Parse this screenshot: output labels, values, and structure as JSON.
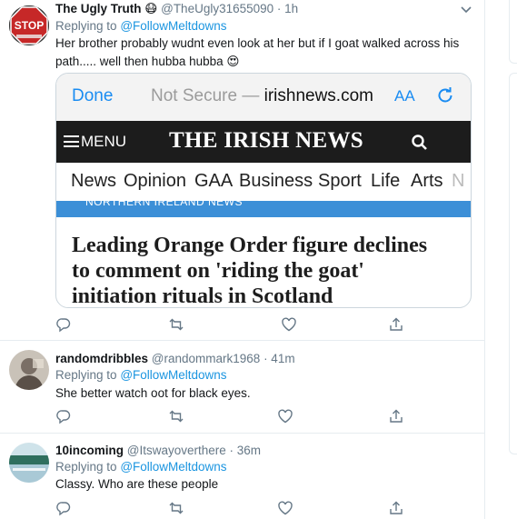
{
  "tweets": [
    {
      "name": "The Ugly Truth",
      "emoji": "😷",
      "handle": "@TheUgly31655090",
      "time": "· 1h",
      "replying_prefix": "Replying to",
      "replying_to": "@FollowMeltdowns",
      "text_line1": "Her brother probably wudnt even look at her but if I goat walked across his",
      "text_line2": "path..... well then hubba hubba",
      "text_emoji": "😍",
      "avatar_text": "STOP",
      "avatar_icon": "stop-sign-icon"
    },
    {
      "name": "randomdribbles",
      "handle": "@randommark1968",
      "time": "· 41m",
      "replying_prefix": "Replying to",
      "replying_to": "@FollowMeltdowns",
      "text": "She better watch oot for black eyes.",
      "avatar_icon": "photo-avatar"
    },
    {
      "name": "10incoming",
      "handle": "@Itswayoverthere",
      "time": "· 36m",
      "replying_prefix": "Replying to",
      "replying_to": "@FollowMeltdowns",
      "text": "Classy. Who are these people",
      "avatar_icon": "landscape-avatar"
    }
  ],
  "embedded_screenshot": {
    "done": "Done",
    "not_secure": "Not Secure —",
    "domain": "irishnews.com",
    "aa": "AA",
    "menu": "MENU",
    "masthead": "THE IRISH NEWS",
    "nav": [
      "News",
      "Opinion",
      "GAA",
      "Business",
      "Sport",
      "Life",
      "Arts",
      "N"
    ],
    "section_strip": "NORTHERN IRELAND NEWS",
    "headline_lines": [
      "Leading Orange Order figure declines",
      "to comment on 'riding the goat'",
      "initiation rituals in Scotland"
    ]
  },
  "icons": {
    "reply": "reply-icon",
    "retweet": "retweet-icon",
    "like": "heart-icon",
    "share": "share-icon",
    "more": "chevron-down-icon"
  },
  "colors": {
    "link": "#1b95e0",
    "muted": "#657786",
    "divider": "#e6ecf0",
    "safari_blue": "#1a8cf2",
    "irish_bar": "#1c1c1c",
    "strip_blue": "#3c8fd7"
  }
}
